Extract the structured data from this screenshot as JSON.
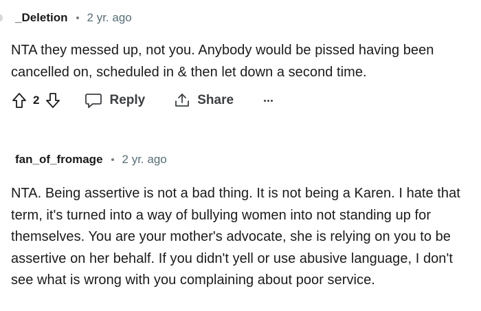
{
  "comments": [
    {
      "username": "_Deletion",
      "age": "2 yr. ago",
      "text": "NTA they messed up, not you. Anybody would be pissed having been cancelled on, scheduled in & then let down a second time.",
      "votes": "2",
      "actions": {
        "reply_label": "Reply",
        "share_label": "Share"
      },
      "icons": [
        "upvote-icon",
        "downvote-icon",
        "reply-icon",
        "share-icon",
        "more-icon"
      ]
    },
    {
      "username": "fan_of_fromage",
      "age": "2 yr. ago",
      "text": "NTA. Being assertive is not a bad thing. It is not being a Karen. I hate that term, it's turned into a way of bullying women into not standing up for themselves. You are your mother's advocate, she is relying on you to be assertive on her behalf. If you didn't yell or use abusive language, I don't see what is wrong with you complaining about poor service."
    }
  ]
}
